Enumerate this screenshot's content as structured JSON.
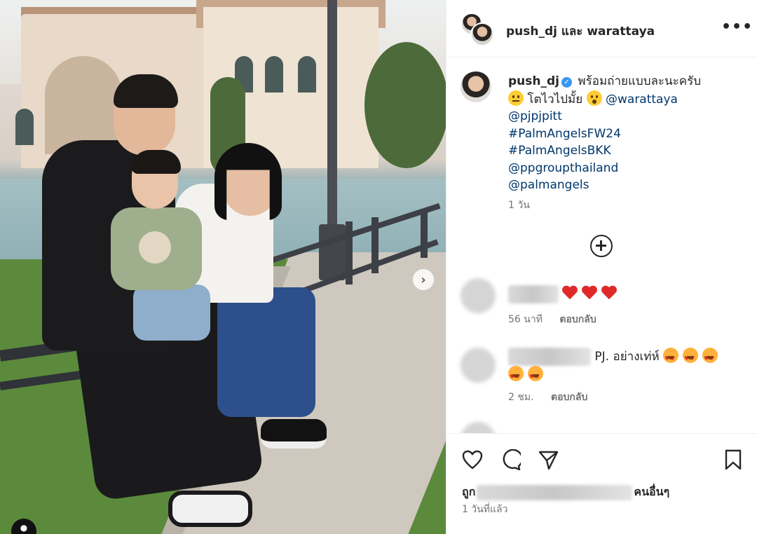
{
  "header": {
    "title": "push_dj และ warattaya",
    "more_label": "•••"
  },
  "caption": {
    "username": "push_dj",
    "text_line1": "พร้อมถ่ายแบบละนะครับ",
    "text_line2": "โตไวไปมั้ย",
    "mention1": "@warattaya",
    "links": [
      "@pjpjpitt",
      "#PalmAngelsFW24",
      "#PalmAngelsBKK",
      "@ppgroupthailand",
      "@palmangels"
    ],
    "time": "1 วัน"
  },
  "comments": [
    {
      "time": "56 นาที",
      "reply": "ตอบกลับ",
      "hearts": 3
    },
    {
      "text": "PJ. อย่างเท่ห์",
      "time": "2 ชม.",
      "reply": "ตอบกลับ"
    }
  ],
  "likes": {
    "prefix": "ถูก",
    "suffix": "คนอื่นๆ"
  },
  "post_time": "1 วันที่แล้ว",
  "icons": {
    "verified": "verified-badge-icon",
    "load_more": "plus-circle-icon",
    "like": "heart-outline-icon",
    "comment": "comment-bubble-icon",
    "share": "send-paper-plane-icon",
    "save": "bookmark-icon",
    "carousel": "chevron-right-icon"
  },
  "colors": {
    "link": "#00376b",
    "verified": "#3897f0",
    "muted": "#737373",
    "text": "#262626"
  }
}
